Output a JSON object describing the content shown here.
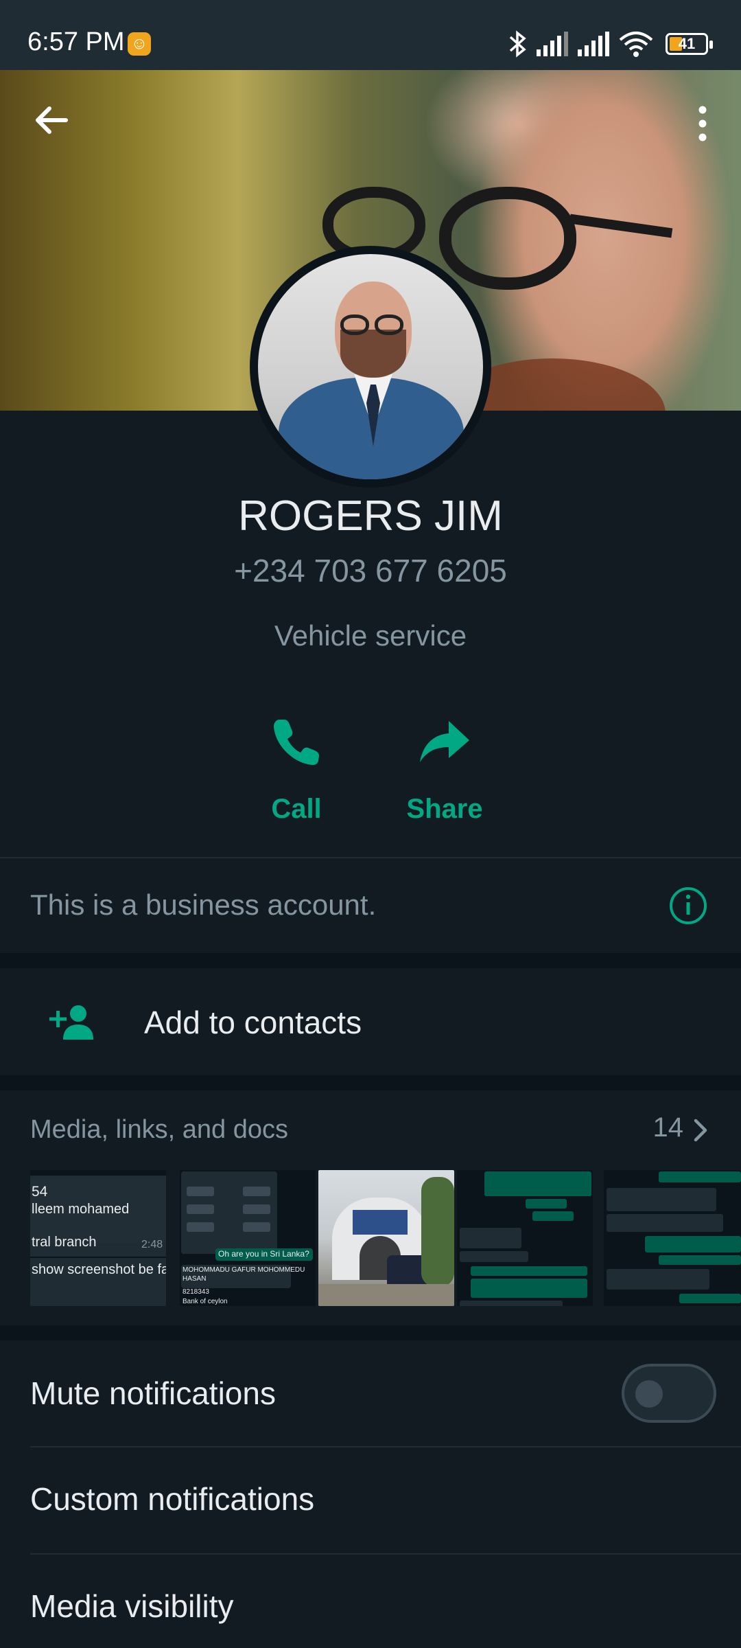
{
  "status_bar": {
    "time": "6:57 PM",
    "battery": "41"
  },
  "profile": {
    "name": "ROGERS JIM",
    "phone": "+234 703 677 6205",
    "about": "Vehicle service"
  },
  "actions": [
    {
      "label": "Call",
      "icon": "phone-icon"
    },
    {
      "label": "Share",
      "icon": "share-arrow-icon"
    }
  ],
  "business_notice": "This is a business account.",
  "add_contact": {
    "label": "Add to contacts"
  },
  "media": {
    "title": "Media, links, and docs",
    "count": "14",
    "thumb1": {
      "line1": "54",
      "line2": "lleem mohamed",
      "line3": "tral branch",
      "time": "2:48",
      "line4": "show screenshot be fa"
    },
    "thumb2": {
      "bubble": "Oh are you in Sri Lanka?",
      "line1": "MOHOMMADU GAFUR MOHOMMEDU",
      "line2": "HASAN",
      "line3": "8218343",
      "line4": "Bank of ceylon"
    }
  },
  "settings": {
    "mute": "Mute notifications",
    "custom": "Custom notifications",
    "visibility": "Media visibility"
  },
  "colors": {
    "accent": "#00a884",
    "background": "#111b21",
    "secondary_text": "#8696a0"
  }
}
